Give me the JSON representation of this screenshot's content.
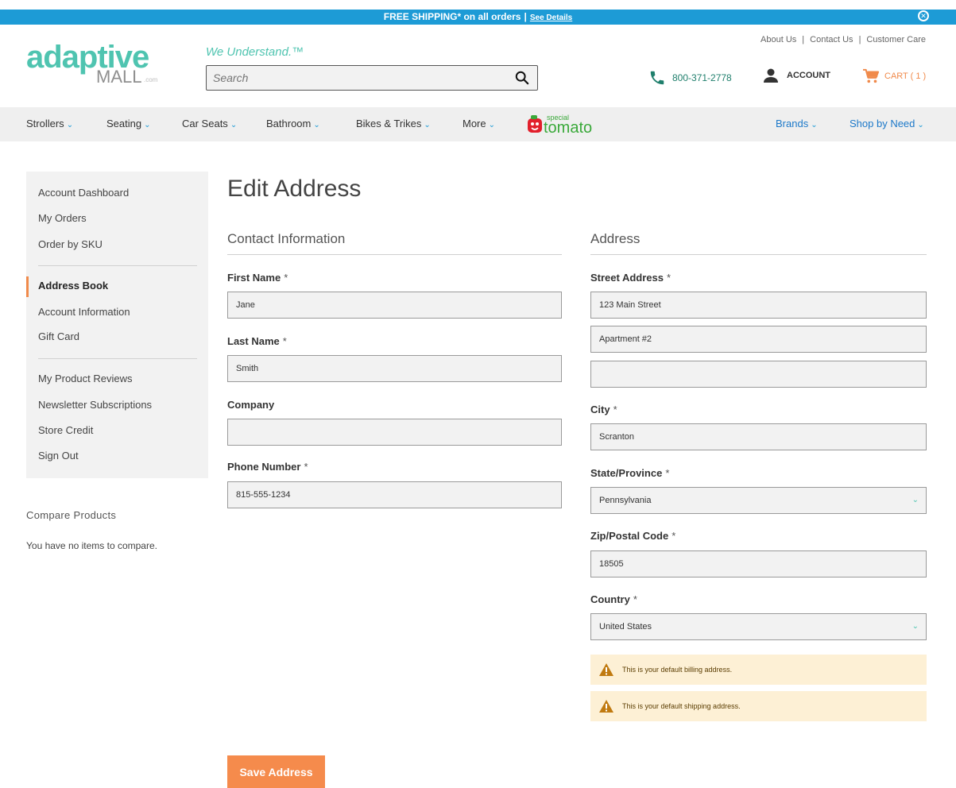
{
  "promo": {
    "text": "FREE SHIPPING* on all orders",
    "separator": "|",
    "link": "See Details",
    "close_icon": "close-circle-icon"
  },
  "header": {
    "logo_main": "adaptive",
    "logo_sub": "MALL",
    "logo_suffix": ".com",
    "tagline": "We Understand.™",
    "search_placeholder": "Search",
    "top_links": [
      "About Us",
      "Contact Us",
      "Customer Care"
    ],
    "phone": "800-371-2778",
    "account": "ACCOUNT",
    "cart": "CART ( 1 )"
  },
  "nav": {
    "items": [
      "Strollers",
      "Seating",
      "Car Seats",
      "Bathroom",
      "Bikes & Trikes",
      "More"
    ],
    "brand_logo_top": "special",
    "brand_logo_main": "tomato",
    "right_items": [
      "Brands",
      "Shop by Need"
    ],
    "chevron": "⌄"
  },
  "sidebar": {
    "group1": [
      "Account Dashboard",
      "My Orders",
      "Order by SKU"
    ],
    "group2": [
      "Address Book",
      "Account Information",
      "Gift Card"
    ],
    "group3": [
      "My Product Reviews",
      "Newsletter Subscriptions",
      "Store Credit",
      "Sign Out"
    ],
    "active": "Address Book"
  },
  "compare": {
    "title": "Compare Products",
    "empty": "You have no items to compare."
  },
  "page": {
    "title": "Edit Address",
    "contact_section": "Contact Information",
    "address_section": "Address",
    "required_mark": "*"
  },
  "contact": {
    "first_name_label": "First Name",
    "first_name": "Jane",
    "last_name_label": "Last Name",
    "last_name": "Smith",
    "company_label": "Company",
    "company": "",
    "phone_label": "Phone Number",
    "phone": "815-555-1234"
  },
  "address": {
    "street_label": "Street Address",
    "street1": "123 Main Street",
    "street2": "Apartment #2",
    "street3": "",
    "city_label": "City",
    "city": "Scranton",
    "state_label": "State/Province",
    "state": "Pennsylvania",
    "zip_label": "Zip/Postal Code",
    "zip": "18505",
    "country_label": "Country",
    "country": "United States"
  },
  "notices": {
    "billing": "This is your default billing address.",
    "shipping": "This is your default shipping address."
  },
  "actions": {
    "save": "Save Address"
  },
  "colors": {
    "brand_teal": "#4fc4b0",
    "promo_blue": "#1d9bd6",
    "accent_orange": "#f58b4c",
    "warning_bg": "#fdf0d5"
  }
}
